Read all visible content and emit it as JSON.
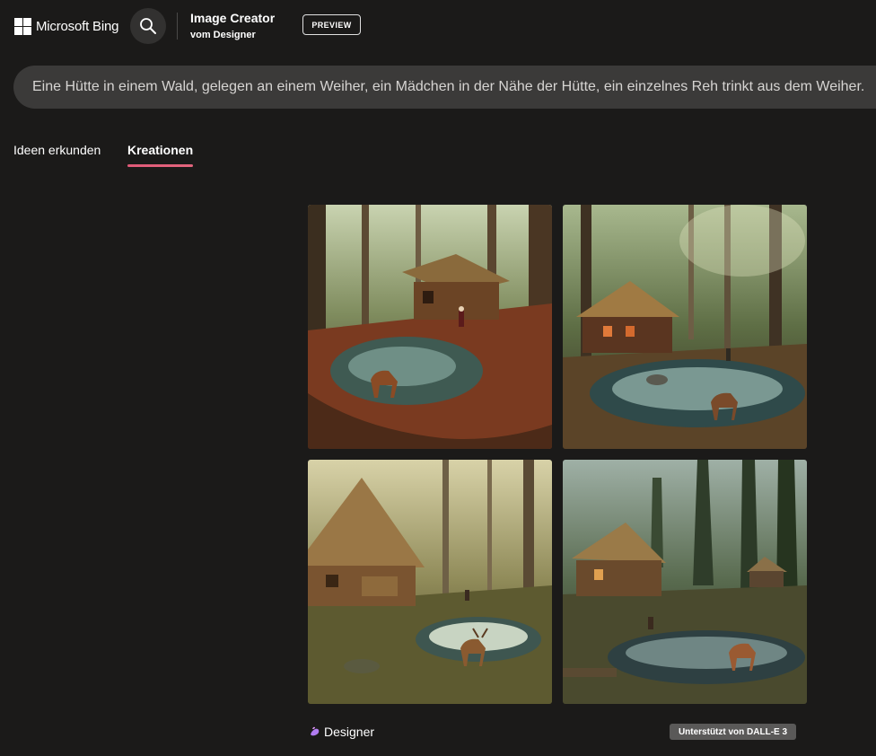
{
  "header": {
    "brand": "Microsoft Bing",
    "app_title": "Image Creator",
    "app_subtitle": "vom Designer",
    "preview_label": "PREVIEW"
  },
  "prompt": {
    "text": "Eine Hütte in einem Wald, gelegen an einem Weiher, ein Mädchen in der Nähe der Hütte, ein einzelnes Reh trinkt aus dem Weiher."
  },
  "tabs": [
    {
      "label": "Ideen erkunden",
      "active": false
    },
    {
      "label": "Kreationen",
      "active": true
    }
  ],
  "images": [
    {
      "scene": "cabin-forest-pond-deer"
    },
    {
      "scene": "cabin-forest-pond-deer"
    },
    {
      "scene": "cabin-forest-pond-deer"
    },
    {
      "scene": "cabin-forest-pond-deer"
    }
  ],
  "footer": {
    "designer_label": "Designer",
    "powered_by": "Unterstützt von DALL-E 3"
  },
  "icons": {
    "search": "search-icon",
    "designer": "designer-logo-icon",
    "microsoft": "microsoft-logo-icon"
  },
  "colors": {
    "background": "#1b1a19",
    "prompt_bg": "#3b3a39",
    "tab_accent": "#e05a78",
    "badge_bg": "#5a5958"
  }
}
